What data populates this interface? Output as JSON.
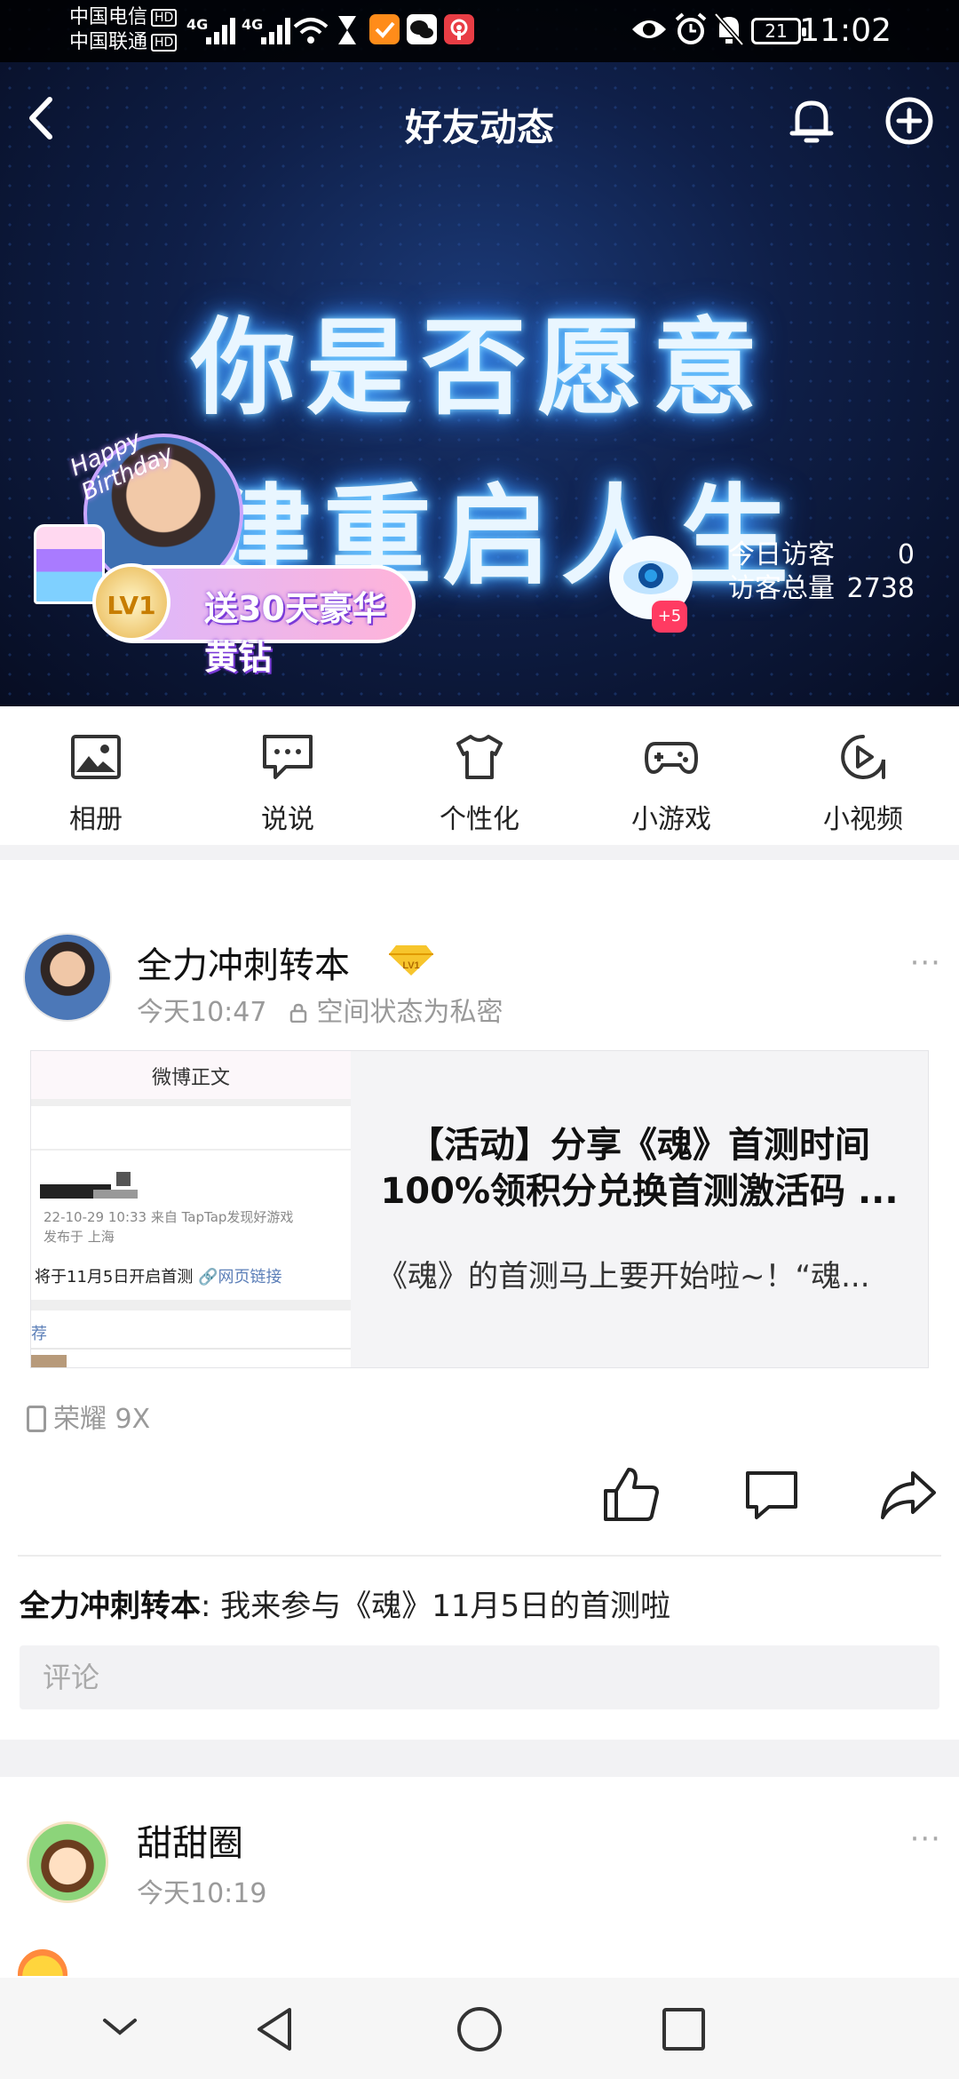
{
  "status_bar": {
    "carrier1": "中国电信",
    "carrier2": "中国联通",
    "hd": "HD",
    "net1": "4G",
    "net2": "4G",
    "battery": "21",
    "time": "11:02"
  },
  "nav": {
    "title": "好友动态"
  },
  "hero": {
    "line1": "你是否愿意",
    "line2": "建重启人生",
    "birthday": "Happy Birthday",
    "level": "LV1",
    "promo_text": "送30天豪华黄钻",
    "eye_badge": "+5",
    "today_visitors_label": "今日访客",
    "today_visitors_value": "0",
    "total_visitors_label": "访客总量",
    "total_visitors_value": "2738"
  },
  "quick_menu": [
    {
      "label": "相册",
      "icon": "photo-icon"
    },
    {
      "label": "说说",
      "icon": "chat-bubble-icon"
    },
    {
      "label": "个性化",
      "icon": "tshirt-icon"
    },
    {
      "label": "小游戏",
      "icon": "gamepad-icon"
    },
    {
      "label": "小视频",
      "icon": "play-icon"
    }
  ],
  "post1": {
    "author": "全力冲刺转本",
    "time": "今天10:47",
    "privacy": "空间状态为私密",
    "more": "···",
    "thumb_header": "微博正文",
    "thumb_line1": "22-10-29 10:33  来自 TapTap发现好游戏",
    "thumb_line2": "发布于 上海",
    "thumb_line3": "将于11月5日开启首测 ",
    "thumb_link": "🔗网页链接",
    "thumb_line4": "荐",
    "share_title_1": "【活动】分享《魂》首测时间",
    "share_title_2": "100%领积分兑换首测激活码 ...",
    "share_desc": "《魂》的首测马上要开始啦~！“魂...",
    "device": "荣耀 9X",
    "comment_author": "全力冲刺转本",
    "comment_text": ": 我来参与《魂》11月5日的首测啦",
    "comment_placeholder": "评论"
  },
  "post2": {
    "author": "甜甜圈",
    "time": "今天10:19",
    "more": "···"
  },
  "colors": {
    "hero_bg": "#0f1f48",
    "badge_red": "#f23b3b",
    "meta_gray": "#9a9a9a"
  }
}
